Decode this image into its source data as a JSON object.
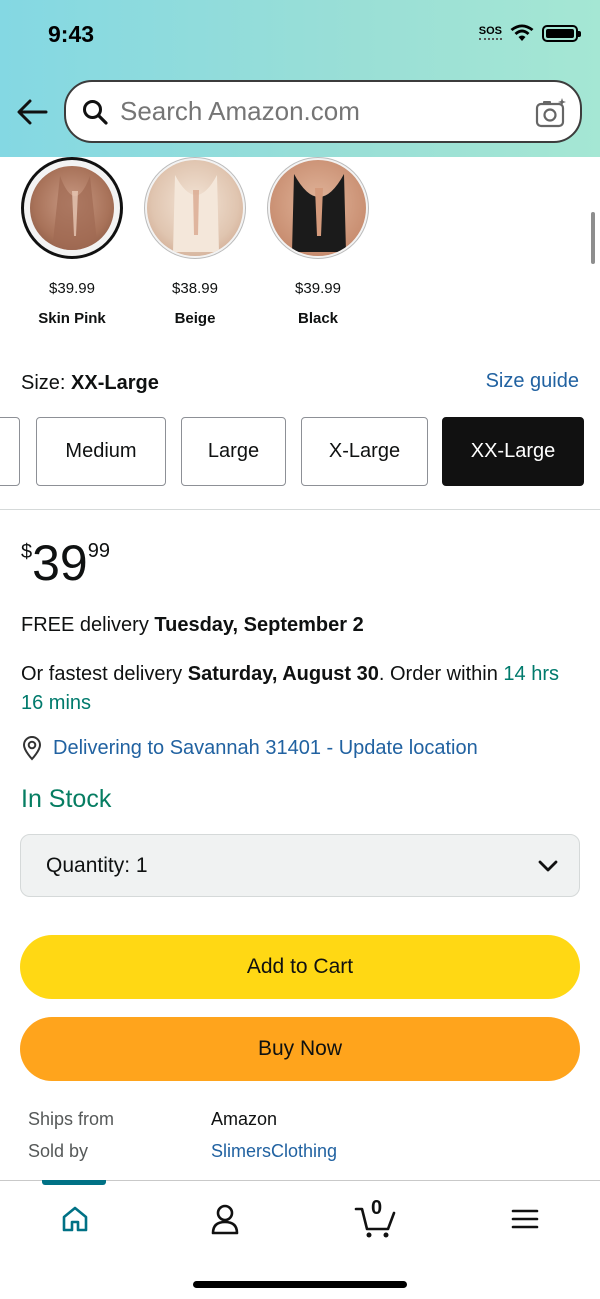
{
  "status": {
    "time": "9:43",
    "sos": "SOS"
  },
  "search": {
    "placeholder": "Search Amazon.com"
  },
  "variants": [
    {
      "price": "$39.99",
      "name": "Skin Pink",
      "color": "#b8836c",
      "selected": true
    },
    {
      "price": "$38.99",
      "name": "Beige",
      "color": "#eedccc",
      "selected": false
    },
    {
      "price": "$39.99",
      "name": "Black",
      "color": "#1d1d1d",
      "selected": false
    }
  ],
  "size": {
    "label": "Size:",
    "selected": "XX-Large",
    "guide": "Size guide",
    "options": [
      "Medium",
      "Large",
      "X-Large",
      "XX-Large"
    ]
  },
  "price": {
    "symbol": "$",
    "whole": "39",
    "fraction": "99"
  },
  "delivery": {
    "prefix": "FREE delivery",
    "date": "Tuesday, September 2",
    "fastest_prefix": "Or fastest delivery",
    "fastest_date": "Saturday, August 30",
    "order_within": ". Order within",
    "countdown": "14 hrs 16 mins",
    "location": "Delivering to Savannah 31401 - Update location"
  },
  "stock": "In Stock",
  "quantity": {
    "label": "Quantity:",
    "value": "1"
  },
  "buttons": {
    "add_to_cart": "Add to Cart",
    "buy_now": "Buy Now"
  },
  "info": {
    "ships_from_label": "Ships from",
    "ships_from": "Amazon",
    "sold_by_label": "Sold by",
    "sold_by": "SlimersClothing"
  },
  "cart_count": "0",
  "colors": {
    "accent": "#007185",
    "add_to_cart": "#ffd814",
    "buy_now": "#ffa41c",
    "link": "#2162a1",
    "stock": "#067d62"
  }
}
